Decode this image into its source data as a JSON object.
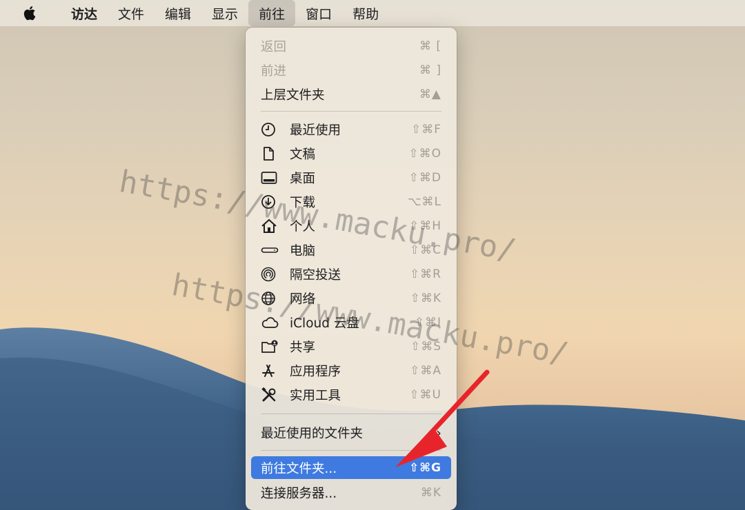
{
  "menubar": {
    "apple_icon": "apple-logo-icon",
    "items": [
      "访达",
      "文件",
      "编辑",
      "显示",
      "前往",
      "窗口",
      "帮助"
    ],
    "active": "前往"
  },
  "menu": {
    "nav": [
      {
        "label": "返回",
        "shortcut": "⌘ [",
        "disabled": true
      },
      {
        "label": "前进",
        "shortcut": "⌘ ]",
        "disabled": true
      },
      {
        "label": "上层文件夹",
        "shortcut": "⌘▲",
        "disabled": false
      }
    ],
    "places": [
      {
        "label": "最近使用",
        "shortcut": "⇧⌘F",
        "icon": "clock-icon"
      },
      {
        "label": "文稿",
        "shortcut": "⇧⌘O",
        "icon": "document-icon"
      },
      {
        "label": "桌面",
        "shortcut": "⇧⌘D",
        "icon": "desktop-icon"
      },
      {
        "label": "下载",
        "shortcut": "⌥⌘L",
        "icon": "download-icon"
      },
      {
        "label": "个人",
        "shortcut": "⇧⌘H",
        "icon": "home-icon"
      },
      {
        "label": "电脑",
        "shortcut": "⇧⌘C",
        "icon": "computer-icon"
      },
      {
        "label": "隔空投送",
        "shortcut": "⇧⌘R",
        "icon": "airdrop-icon"
      },
      {
        "label": "网络",
        "shortcut": "⇧⌘K",
        "icon": "network-icon"
      },
      {
        "label": "iCloud 云盘",
        "shortcut": "⇧⌘I",
        "icon": "cloud-icon"
      },
      {
        "label": "共享",
        "shortcut": "⇧⌘S",
        "icon": "shared-folder-icon"
      },
      {
        "label": "应用程序",
        "shortcut": "⇧⌘A",
        "icon": "applications-icon"
      },
      {
        "label": "实用工具",
        "shortcut": "⇧⌘U",
        "icon": "utilities-icon"
      }
    ],
    "recent_folders": "最近使用的文件夹",
    "go_to_folder": {
      "label": "前往文件夹...",
      "shortcut": "⇧⌘G"
    },
    "connect_server": {
      "label": "连接服务器...",
      "shortcut": "⌘K"
    }
  },
  "watermark": [
    "https://www.macku.pro/",
    "https://www.macku.pro/"
  ],
  "colors": {
    "selection": "#3f7ae0",
    "arrow": "#e8242b"
  }
}
